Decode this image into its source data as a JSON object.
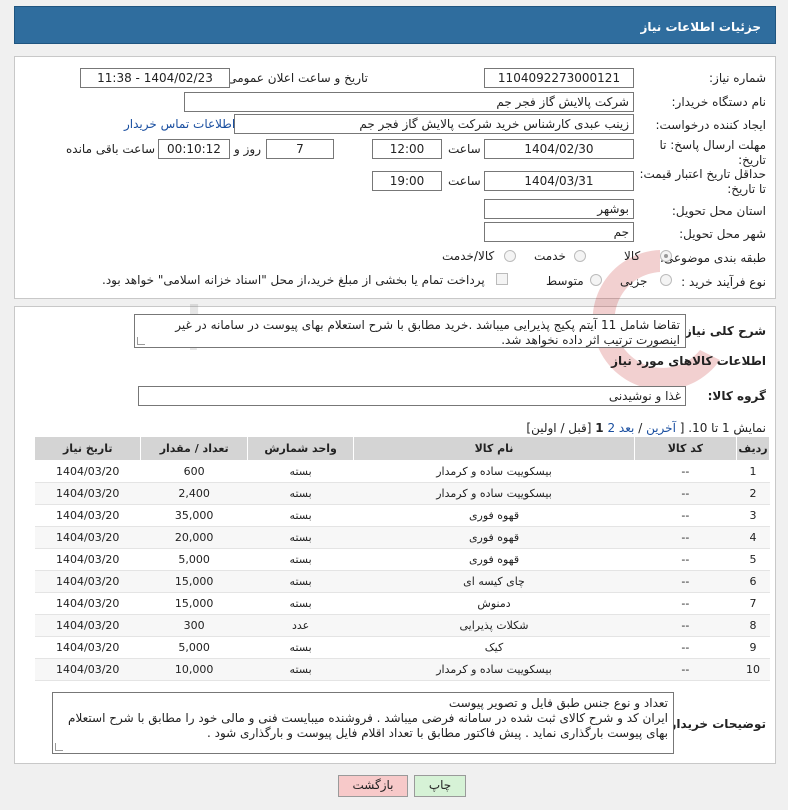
{
  "header": {
    "title": "جزئیات اطلاعات نیاز"
  },
  "form": {
    "need_number_label": "شماره نیاز:",
    "need_number": "1104092273000121",
    "announce_label": "تاریخ و ساعت اعلان عمومی:",
    "announce_value": "1404/02/23 - 11:38",
    "buyer_org_label": "نام دستگاه خریدار:",
    "buyer_org": "شرکت پالایش گاز فجر جم",
    "creator_label": "ایجاد کننده درخواست:",
    "creator": "زینب عبدی کارشناس خرید شرکت پالایش گاز فجر جم",
    "contact_link": "اطلاعات تماس خریدار",
    "deadline_label_1": "مهلت ارسال پاسخ: تا",
    "deadline_label_2": "تاریخ:",
    "deadline_date": "1404/02/30",
    "time_label": "ساعت",
    "deadline_time": "12:00",
    "days_value": "7",
    "days_label": "روز و",
    "remaining_time": "00:10:12",
    "remaining_label": "ساعت باقی مانده",
    "validity_label_1": "حداقل تاریخ اعتبار قیمت:",
    "validity_label_2": "تا تاریخ:",
    "validity_date": "1404/03/31",
    "validity_time": "19:00",
    "province_label": "استان محل تحویل:",
    "province": "بوشهر",
    "city_label": "شهر محل تحویل:",
    "city": "جم",
    "category_label": "طبقه بندی موضوعی:",
    "category_options": [
      "کالا",
      "خدمت",
      "کالا/خدمت"
    ],
    "category_selected": "کالا",
    "process_label": "نوع فرآیند خرید :",
    "process_options": [
      "جزیی",
      "متوسط"
    ],
    "payment_note": "پرداخت تمام یا بخشی از مبلغ خرید،از محل \"اسناد خزانه اسلامی\" خواهد بود."
  },
  "details": {
    "description_label": "شرح کلی نیاز:",
    "description": "تقاضا شامل 11 آیتم پکیج پذیرایی میباشد .خرید مطابق با شرح استعلام بهای پیوست در سامانه در غیر اینصورت ترتیب اثر داده نخواهد شد.",
    "items_title": "اطلاعات کالاهای مورد نیاز",
    "group_label": "گروه کالا:",
    "group_value": "غذا و نوشیدنی",
    "pager": {
      "prefix": "نمایش 1 تا 10. [",
      "last": "آخرین",
      "next": "بعد",
      "page2": "2",
      "page1": "1",
      "suffix": "[قبل / اولین]"
    }
  },
  "table": {
    "headers": [
      "ردیف",
      "کد کالا",
      "نام کالا",
      "واحد شمارش",
      "تعداد / مقدار",
      "تاریخ نیاز"
    ],
    "rows": [
      [
        "1",
        "--",
        "بیسکوییت ساده و کرمدار",
        "بسته",
        "600",
        "1404/03/20"
      ],
      [
        "2",
        "--",
        "بیسکوییت ساده و کرمدار",
        "بسته",
        "2,400",
        "1404/03/20"
      ],
      [
        "3",
        "--",
        "قهوه فوری",
        "بسته",
        "35,000",
        "1404/03/20"
      ],
      [
        "4",
        "--",
        "قهوه فوری",
        "بسته",
        "20,000",
        "1404/03/20"
      ],
      [
        "5",
        "--",
        "قهوه فوری",
        "بسته",
        "5,000",
        "1404/03/20"
      ],
      [
        "6",
        "--",
        "چای کیسه ای",
        "بسته",
        "15,000",
        "1404/03/20"
      ],
      [
        "7",
        "--",
        "دمنوش",
        "بسته",
        "15,000",
        "1404/03/20"
      ],
      [
        "8",
        "--",
        "شکلات پذیرایی",
        "عدد",
        "300",
        "1404/03/20"
      ],
      [
        "9",
        "--",
        "کیک",
        "بسته",
        "5,000",
        "1404/03/20"
      ],
      [
        "10",
        "--",
        "بیسکوییت ساده و کرمدار",
        "بسته",
        "10,000",
        "1404/03/20"
      ]
    ]
  },
  "buyer_notes": {
    "label": "توضیحات خریدار:",
    "line1": "تعداد و نوع جنس طبق فایل و تصویر پیوست",
    "line2": "ایران کد و شرح کالای ثبت شده در سامانه فرضی میباشد . فروشنده میبایست فنی و مالی خود را مطابق با شرح استعلام بهای پیوست بارگذاری نماید . پیش فاکتور مطابق با تعداد اقلام فایل پیوست و بارگذاری شود ."
  },
  "buttons": {
    "print": "چاپ",
    "back": "بازگشت"
  },
  "colors": {
    "header_bg": "#2f6d9e",
    "back_btn": "#f7c9c9",
    "print_btn": "#d6f2d6",
    "link": "#1a4fa0"
  }
}
